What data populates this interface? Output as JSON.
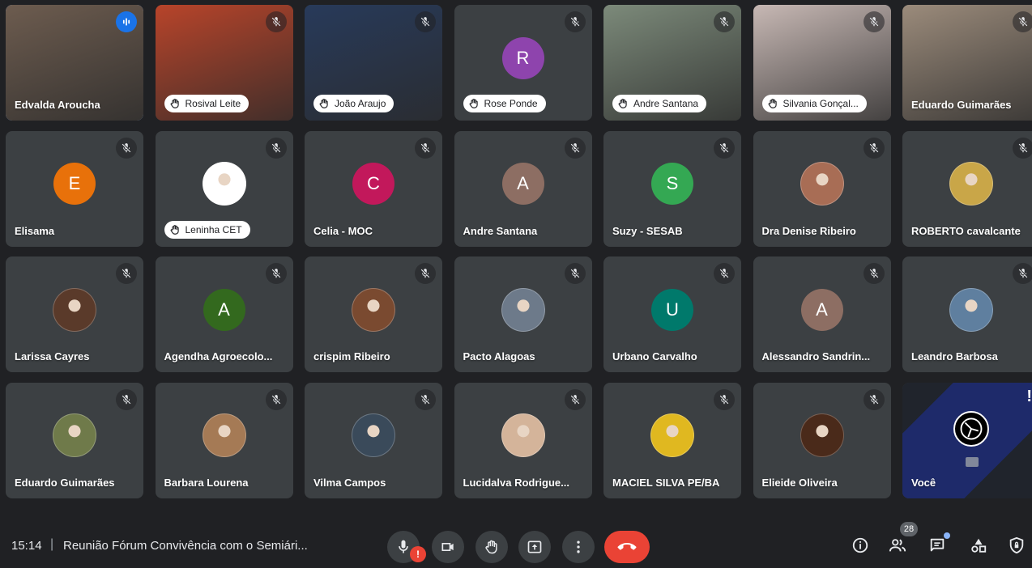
{
  "participants": [
    {
      "name": "Edvalda Aroucha",
      "hand": false,
      "type": "video",
      "speaking": true,
      "bg": "#6d5c4f"
    },
    {
      "name": "Rosival Leite",
      "hand": true,
      "type": "video",
      "bg": "#b8442a"
    },
    {
      "name": "João Araujo",
      "hand": true,
      "type": "video",
      "bg": "#283a5a"
    },
    {
      "name": "Rose Ponde",
      "hand": true,
      "type": "letter",
      "letter": "R",
      "color": "#8e44ad"
    },
    {
      "name": "Andre Santana",
      "hand": true,
      "type": "video",
      "bg": "#7c8a7a"
    },
    {
      "name": "Silvania Gonçal...",
      "hand": true,
      "type": "video",
      "bg": "#c7b8b4"
    },
    {
      "name": "Eduardo Guimarães",
      "hand": false,
      "type": "video",
      "bg": "#9b8b7b"
    },
    {
      "name": "Elisama",
      "hand": false,
      "type": "letter",
      "letter": "E",
      "color": "#e8710a"
    },
    {
      "name": "Leninha CET",
      "hand": true,
      "type": "photo",
      "color": "#ffffff"
    },
    {
      "name": "Celia - MOC",
      "hand": false,
      "type": "letter",
      "letter": "C",
      "color": "#c2185b"
    },
    {
      "name": "Andre Santana",
      "hand": false,
      "type": "letter",
      "letter": "A",
      "color": "#8d6e63"
    },
    {
      "name": "Suzy - SESAB",
      "hand": false,
      "type": "letter",
      "letter": "S",
      "color": "#34a853"
    },
    {
      "name": "Dra Denise Ribeiro",
      "hand": false,
      "type": "photo",
      "color": "#a86d55"
    },
    {
      "name": "ROBERTO cavalcante",
      "hand": false,
      "type": "photo",
      "color": "#c9a648"
    },
    {
      "name": "Larissa Cayres",
      "hand": false,
      "type": "photo",
      "color": "#5a3a2a"
    },
    {
      "name": "Agendha Agroecolo...",
      "hand": false,
      "type": "letter",
      "letter": "A",
      "color": "#33691e"
    },
    {
      "name": "crispim Ribeiro",
      "hand": false,
      "type": "photo",
      "color": "#7a4a30"
    },
    {
      "name": "Pacto Alagoas",
      "hand": false,
      "type": "photo",
      "color": "#6d7a8a"
    },
    {
      "name": "Urbano Carvalho",
      "hand": false,
      "type": "letter",
      "letter": "U",
      "color": "#00796b"
    },
    {
      "name": "Alessandro Sandrin...",
      "hand": false,
      "type": "letter",
      "letter": "A",
      "color": "#8d6e63"
    },
    {
      "name": "Leandro Barbosa",
      "hand": false,
      "type": "photo",
      "color": "#5f7f9f"
    },
    {
      "name": "Eduardo Guimarães",
      "hand": false,
      "type": "photo",
      "color": "#6f7a4a"
    },
    {
      "name": "Barbara Lourena",
      "hand": false,
      "type": "photo",
      "color": "#a57a55"
    },
    {
      "name": "Vilma Campos",
      "hand": false,
      "type": "photo",
      "color": "#3a4a5a"
    },
    {
      "name": "Lucidalva Rodrigue...",
      "hand": false,
      "type": "photo",
      "color": "#d4b49a"
    },
    {
      "name": "MACIEL SILVA PE/BA",
      "hand": false,
      "type": "photo",
      "color": "#e0b820"
    },
    {
      "name": "Elieide Oliveira",
      "hand": false,
      "type": "photo",
      "color": "#4a2a1a"
    },
    {
      "name": "Você",
      "hand": false,
      "type": "self",
      "color": "#1e2a5a"
    }
  ],
  "bar": {
    "time": "15:14",
    "separator": "|",
    "meeting_title": "Reunião Fórum Convivência com o Semiári...",
    "alert_mark": "!",
    "participant_count": "28",
    "self_warning": "!"
  },
  "colors": {
    "background": "#202124",
    "tile": "#3c4043",
    "end_call": "#ea4335",
    "accent": "#8ab4f8"
  }
}
